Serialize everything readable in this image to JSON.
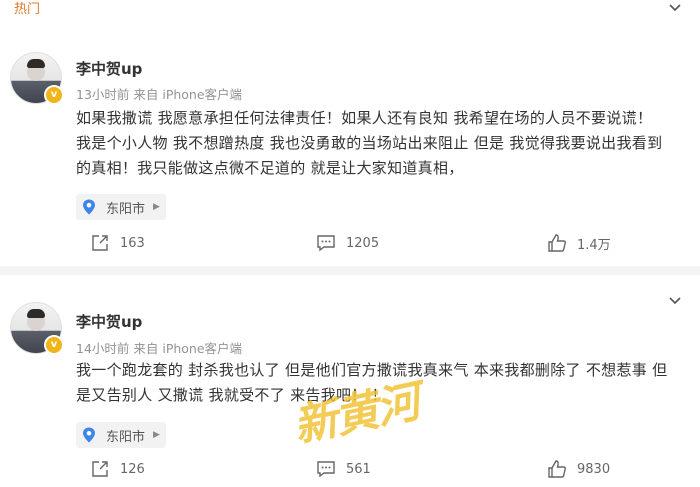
{
  "header": {
    "tab_label": "热门"
  },
  "posts": [
    {
      "username": "李中贺up",
      "meta": "13小时前 来自 iPhone客户端",
      "text_line1": "如果我撒谎 我愿意承担任何法律责任！如果人还有良知 我希望在场的人员不要说谎！",
      "text_line2": "我是个小人物 我不想蹭热度 我也没勇敢的当场站出来阻止 但是 我觉得我要说出我看到",
      "text_line3": "的真相！我只能做这点微不足道的 就是让大家知道真相，",
      "location": "东阳市",
      "reposts": "163",
      "comments": "1205",
      "likes": "1.4万"
    },
    {
      "username": "李中贺up",
      "meta": "14小时前 来自 iPhone客户端",
      "text_line1": "我一个跑龙套的 封杀我也认了 但是他们官方撒谎我真来气 本来我都删除了 不想惹事 但",
      "text_line2": "是又告别人 又撒谎 我就受不了 来告我吧！ ！",
      "location": "东阳市",
      "reposts": "126",
      "comments": "561",
      "likes": "9830"
    }
  ],
  "verified_badge": "v",
  "watermark": "新黄河",
  "colors": {
    "accent": "#e07a2c",
    "badge": "#f2b418",
    "watermark": "#f1c232"
  }
}
